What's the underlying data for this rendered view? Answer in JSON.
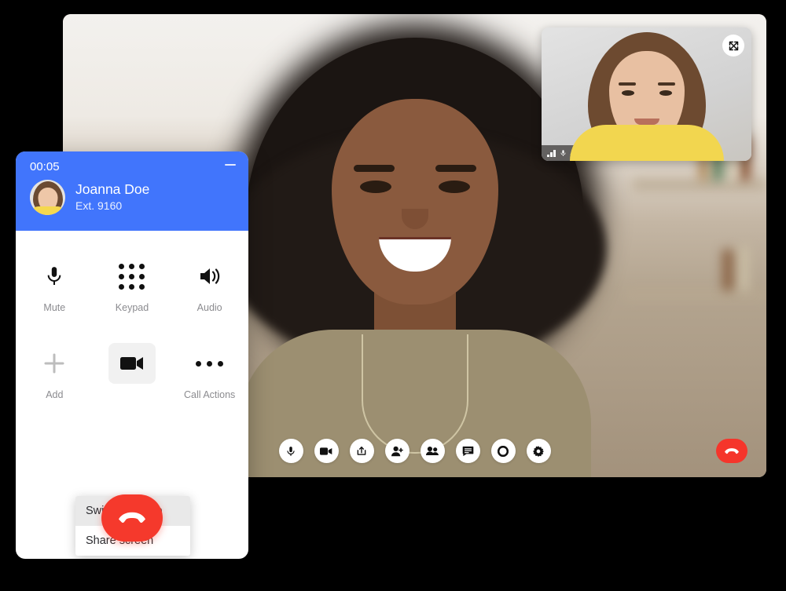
{
  "video_call": {
    "pip": {
      "participant_name": "Joanna Doe",
      "expand_icon": "expand-icon",
      "mic_icon": "microphone-icon",
      "signal_icon": "signal-bars-icon"
    },
    "toolbar": [
      {
        "name": "microphone",
        "icon": "microphone-icon"
      },
      {
        "name": "camera",
        "icon": "video-camera-icon"
      },
      {
        "name": "share",
        "icon": "share-upload-icon"
      },
      {
        "name": "add-participant",
        "icon": "person-add-icon"
      },
      {
        "name": "participants",
        "icon": "people-icon"
      },
      {
        "name": "chat",
        "icon": "chat-bubble-icon"
      },
      {
        "name": "record",
        "icon": "record-circle-icon"
      },
      {
        "name": "settings",
        "icon": "gear-icon"
      }
    ],
    "end_call": {
      "icon": "phone-hangup-icon"
    }
  },
  "dialer": {
    "timer": "00:05",
    "minimize_icon": "minimize-icon",
    "caller": {
      "name": "Joanna Doe",
      "extension": "Ext. 9160",
      "avatar": "avatar"
    },
    "controls_row1": [
      {
        "label": "Mute",
        "icon": "microphone-icon"
      },
      {
        "label": "Keypad",
        "icon": "keypad-dots-icon"
      },
      {
        "label": "Audio",
        "icon": "speaker-icon"
      }
    ],
    "controls_row2": [
      {
        "label": "Add",
        "icon": "plus-icon"
      },
      {
        "label": "",
        "icon": "video-camera-icon"
      },
      {
        "label": "Call Actions",
        "icon": "ellipsis-icon"
      }
    ],
    "context_menu": [
      {
        "label": "Switch to video",
        "active": true
      },
      {
        "label": "Share screen",
        "active": false
      }
    ],
    "end_call": {
      "icon": "phone-hangup-icon"
    }
  },
  "colors": {
    "accent_blue": "#4175fc",
    "danger_red": "#f5392c",
    "label_gray": "#8b8b8f",
    "menu_active": "#e9e9e9"
  }
}
